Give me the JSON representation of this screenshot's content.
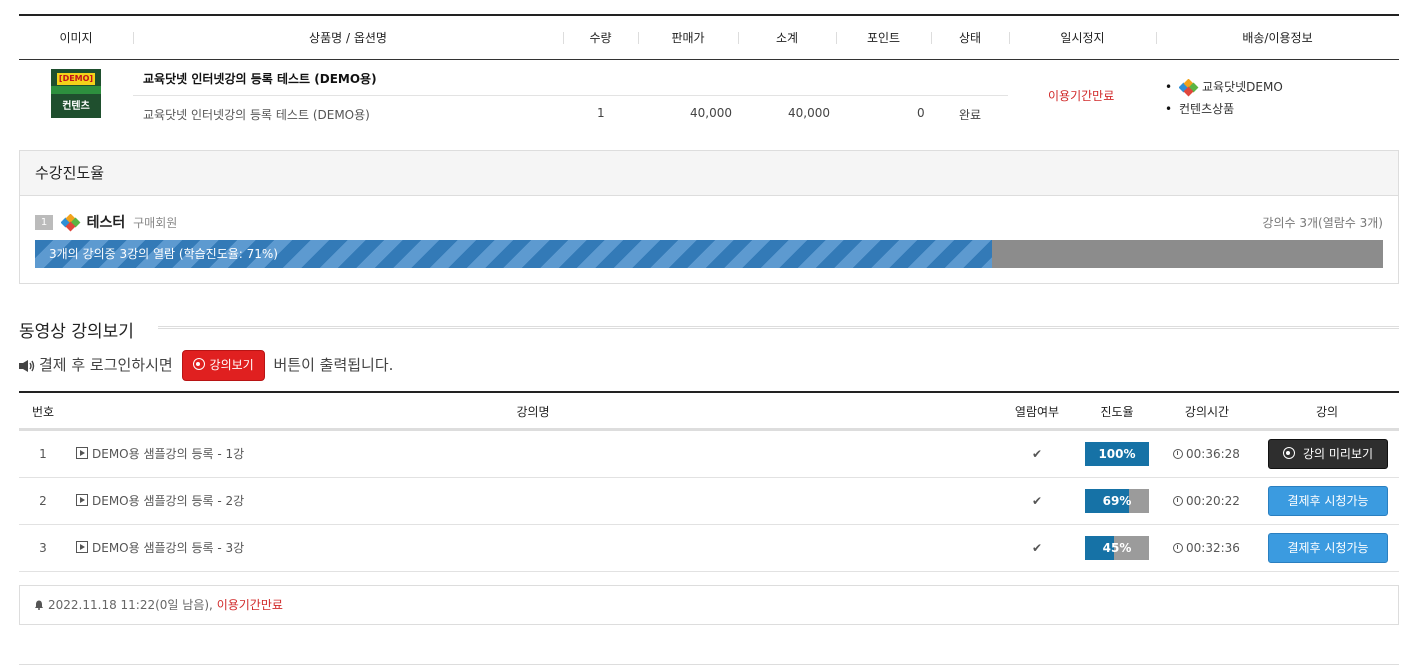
{
  "order": {
    "headers": [
      "이미지",
      "상품명 / 옵션명",
      "수량",
      "판매가",
      "소계",
      "포인트",
      "상태",
      "일시정지",
      "배송/이용정보"
    ],
    "thumb": {
      "tag": "[DEMO]",
      "label": "컨텐츠"
    },
    "product_title": "교육닷넷 인터넷강의 등록 테스트 (DEMO용)",
    "option_name": "교육닷넷 인터넷강의 등록 테스트 (DEMO용)",
    "quantity": "1",
    "price": "40,000",
    "subtotal": "40,000",
    "point": "0",
    "status": "완료",
    "pause": "이용기간만료",
    "shipping": [
      "교육닷넷DEMO",
      "컨텐츠상품"
    ]
  },
  "progress": {
    "title": "수강진도율",
    "learner_no": "1",
    "learner_name": "테스터",
    "learner_role": "구매회원",
    "lecture_count": "강의수 3개(열람수 3개)",
    "bar_text": "3개의 강의중 3강의 열람 (학습진도율: 71%)",
    "percent": 71
  },
  "video": {
    "section_title": "동영상 강의보기",
    "notice_before": "결제 후 로그인하시면",
    "notice_button": "강의보기",
    "notice_after": "버튼이 출력됩니다."
  },
  "lectures": {
    "headers": {
      "no": "번호",
      "name": "강의명",
      "viewed": "열람여부",
      "progress": "진도율",
      "time": "강의시간",
      "lecture": "강의"
    },
    "rows": [
      {
        "no": "1",
        "title": "DEMO용 샘플강의 등록 - 1강",
        "viewed": "✔",
        "progress_label": "100%",
        "progress": 100,
        "time": "00:36:28",
        "button": "강의 미리보기",
        "button_style": "dark"
      },
      {
        "no": "2",
        "title": "DEMO용 샘플강의 등록 - 2강",
        "viewed": "✔",
        "progress_label": "69%",
        "progress": 69,
        "time": "00:20:22",
        "button": "결제후 시청가능",
        "button_style": "blue"
      },
      {
        "no": "3",
        "title": "DEMO용 샘플강의 등록 - 3강",
        "viewed": "✔",
        "progress_label": "45%",
        "progress": 45,
        "time": "00:32:36",
        "button": "결제후 시청가능",
        "button_style": "blue"
      }
    ]
  },
  "expire": {
    "date": "2022.11.18 11:22(0일 남음),",
    "status": "이용기간만료"
  },
  "colors": {
    "accent_red": "#d12a2a",
    "progress_blue": "#1672a6",
    "button_blue": "#3b9be0"
  }
}
